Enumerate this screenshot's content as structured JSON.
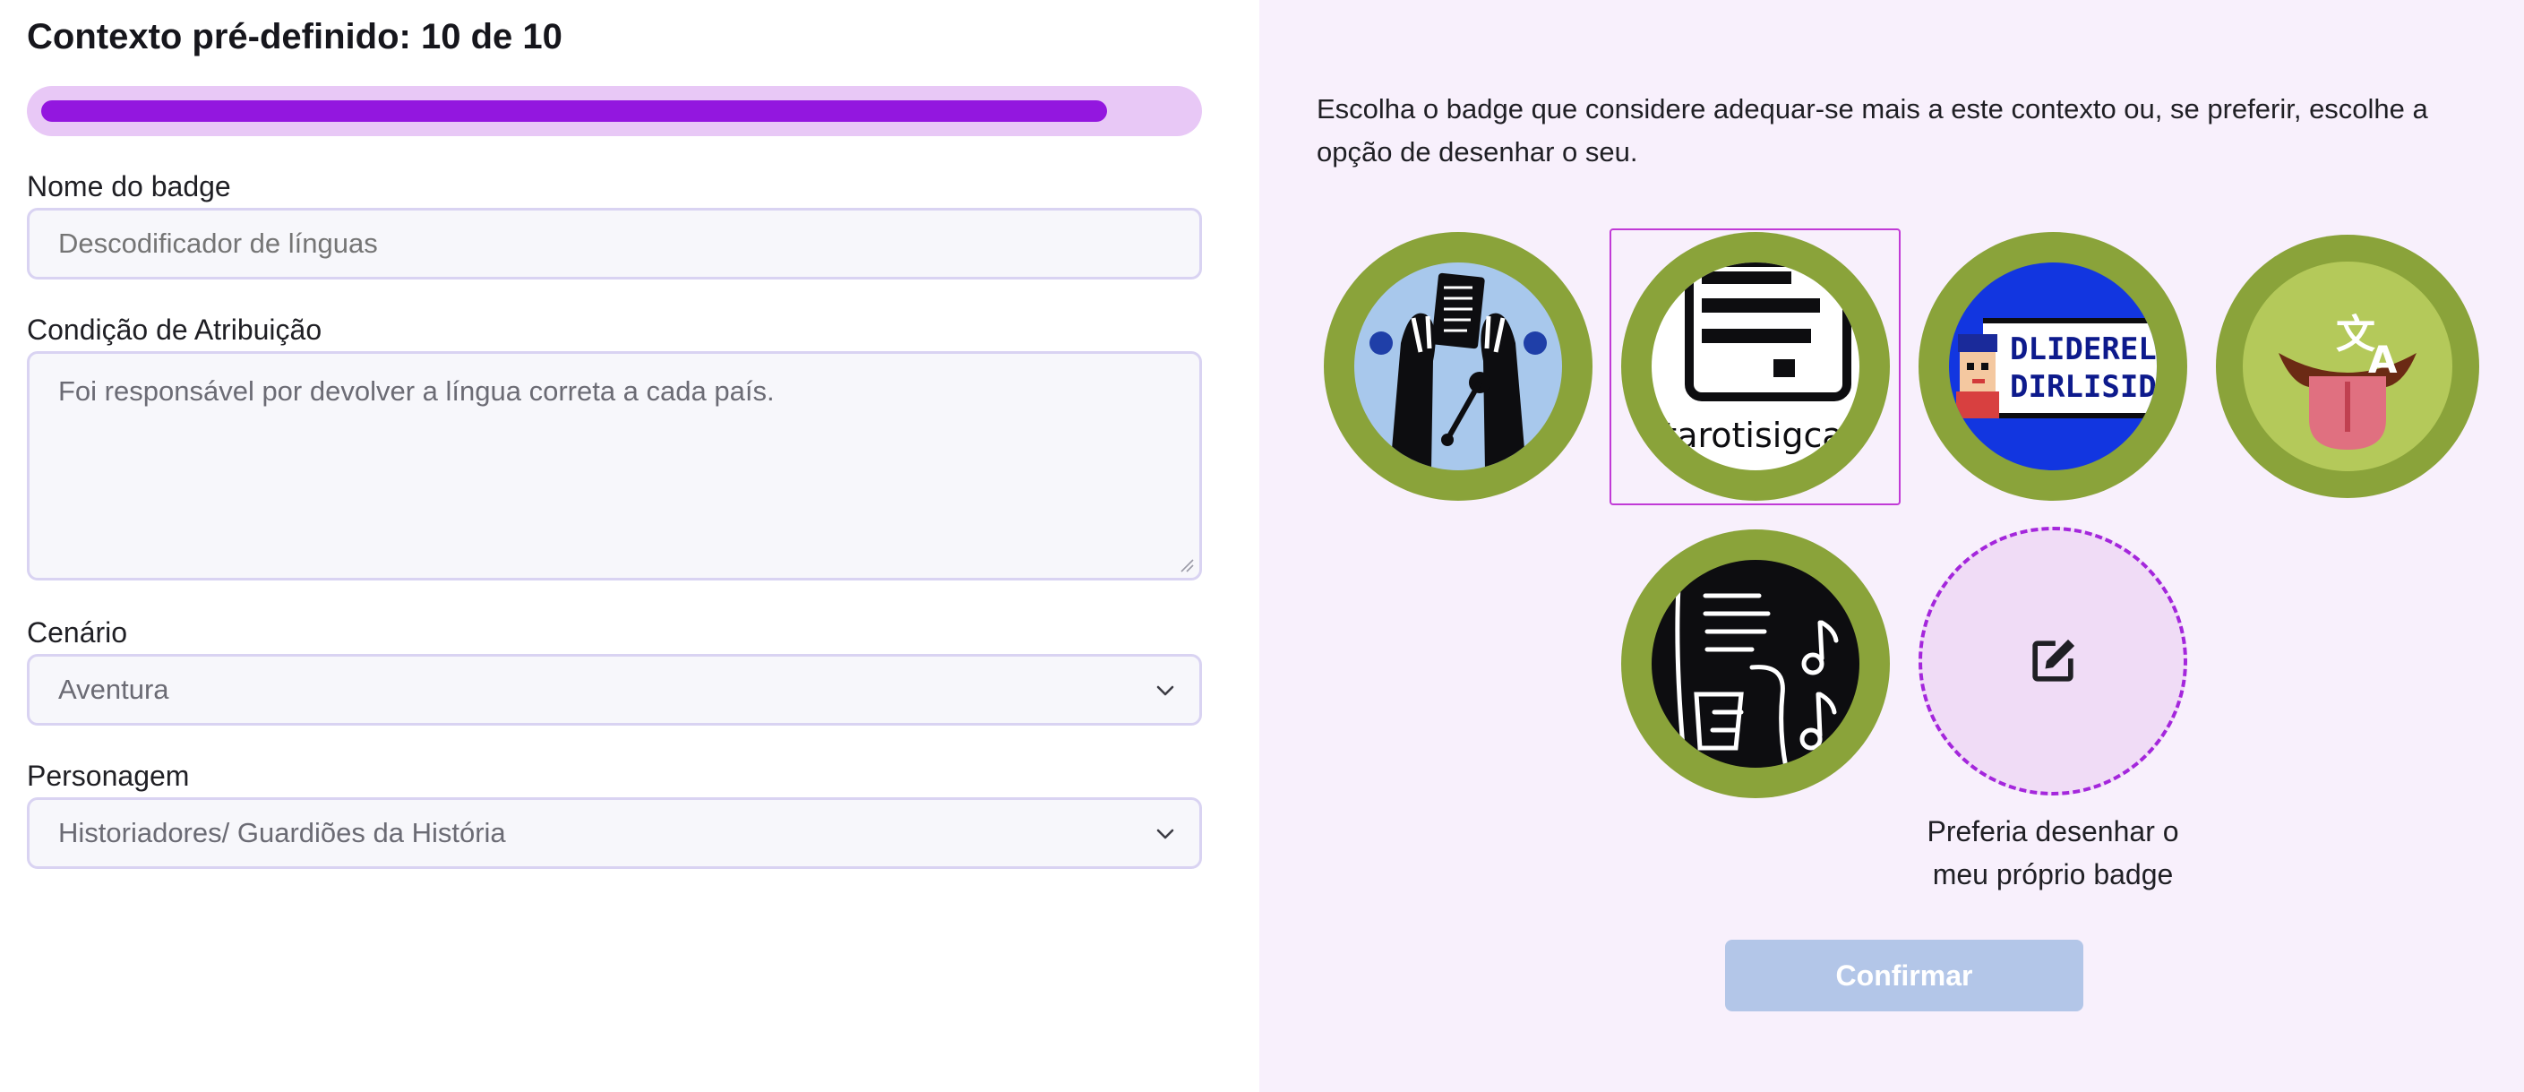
{
  "header": {
    "title": "Contexto pré-definido: 10 de 10"
  },
  "progress": {
    "current": 10,
    "total": 10,
    "fill_fraction": 0.93
  },
  "form": {
    "badge_name": {
      "label": "Nome do badge",
      "placeholder": "Descodificador de línguas"
    },
    "condition": {
      "label": "Condição de Atribuição",
      "placeholder": "Foi responsável por devolver a língua correta a cada país."
    },
    "scenario": {
      "label": "Cenário",
      "value": "Aventura"
    },
    "character": {
      "label": "Personagem",
      "value": "Historiadores/ Guardiões da História"
    }
  },
  "panel": {
    "intro": "Escolha o badge que considere adequar-se mais a este contexto ou, se preferir, escolhe a opção de desenhar o seu.",
    "badges": [
      {
        "icon": "musicians-with-sheet-icon",
        "selected": false
      },
      {
        "icon": "pixel-document-icon",
        "selected": true,
        "text": "itarotisigcar"
      },
      {
        "icon": "pixel-character-sign-icon",
        "selected": false,
        "text_line1": "DLIDERELI",
        "text_line2": "DIRLISIDEF"
      },
      {
        "icon": "tongue-translate-icon",
        "selected": false
      },
      {
        "icon": "music-notes-sketch-icon",
        "selected": false
      }
    ],
    "draw_option": {
      "label_line1": "Preferia desenhar o",
      "label_line2": "meu próprio badge",
      "icon": "edit-icon"
    },
    "confirm_label": "Confirmar"
  },
  "colors": {
    "accent": "#9317df",
    "progress_track": "#e8c8f6",
    "badge_ring": "#8aa33a",
    "panel_bg": "#f8f0fc",
    "confirm_disabled": "#b3c6e8",
    "selected_border": "#c13ad6"
  }
}
